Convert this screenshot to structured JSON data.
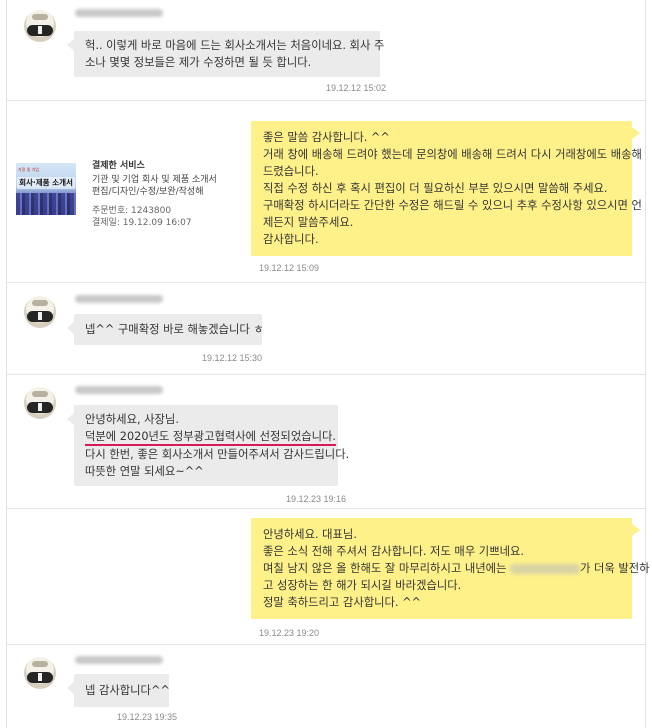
{
  "messages": [
    {
      "sender": "buyer",
      "lines": [
        "헉.. 이렇게 바로 마음에 드는 회사소개서는 처음이네요. 회사 주",
        "소나 몇몇 정보들은 제가 수정하면 될 듯 합니다."
      ],
      "time": "19.12.12 15:02"
    },
    {
      "sender": "seller",
      "lines": [
        "좋은 말씀 감사합니다. ^^",
        "거래 창에 배송해 드려야 했는데 문의창에 배송해 드려서 다시 거래창에도 배송해",
        "드렸습니다.",
        "직접 수정 하신 후 혹시 편집이 더 필요하신 부분 있으시면 말씀해 주세요.",
        "구매확정 하시더라도 간단한 수정은 해드릴 수 있으니 추후 수정사항 있으시면 언",
        "제든지 말씀주세요.",
        "감사합니다."
      ],
      "time": "19.12.12 15:09"
    },
    {
      "sender": "buyer",
      "lines": [
        "넵^^ 구매확정 바로 해놓겠습니다 ㅎ"
      ],
      "time": "19.12.12 15:30"
    },
    {
      "sender": "buyer",
      "lines": [
        "안녕하세요, 사장님.",
        "덕분에 2020년도 정부광고협력사에 선정되었습니다.",
        "다시 한번, 좋은 회사소개서 만들어주셔서 감사드립니다.",
        "따뜻한 연말 되세요~^^"
      ],
      "time": "19.12.23 19:16"
    },
    {
      "sender": "seller",
      "lines": [
        "안녕하세요. 대표님.",
        "좋은 소식 전해 주셔서 감사합니다. 저도 매우 기쁘네요.",
        "며칠 남지 않은 올 한해도 잘 마무리하시고 내년에는",
        "가 더욱 발전하",
        "고 성장하는 한 해가 되시길 바라겠습니다.",
        "정말 축하드리고 감사합니다. ^^"
      ],
      "time": "19.12.23 19:20"
    },
    {
      "sender": "buyer",
      "lines": [
        "넵 감사합니다^^"
      ],
      "time": "19.12.23 19:35"
    }
  ],
  "order_card": {
    "thumb_top": "가정 및 기업",
    "thumb_title": "회사·제품 소개서",
    "service_label": "결제한 서비스",
    "service_line1": "기관 및 기업 회사 및 제품 소개서",
    "service_line2": "편집/디자인/수정/보완/작성해",
    "order_no": "주문번호: 1243800",
    "paid_date": "결제일: 19.12.09 16:07"
  },
  "colors": {
    "incoming_bubble": "#ebebeb",
    "outgoing_bubble": "#fff18a",
    "highlight_underline": "#d6195d"
  }
}
